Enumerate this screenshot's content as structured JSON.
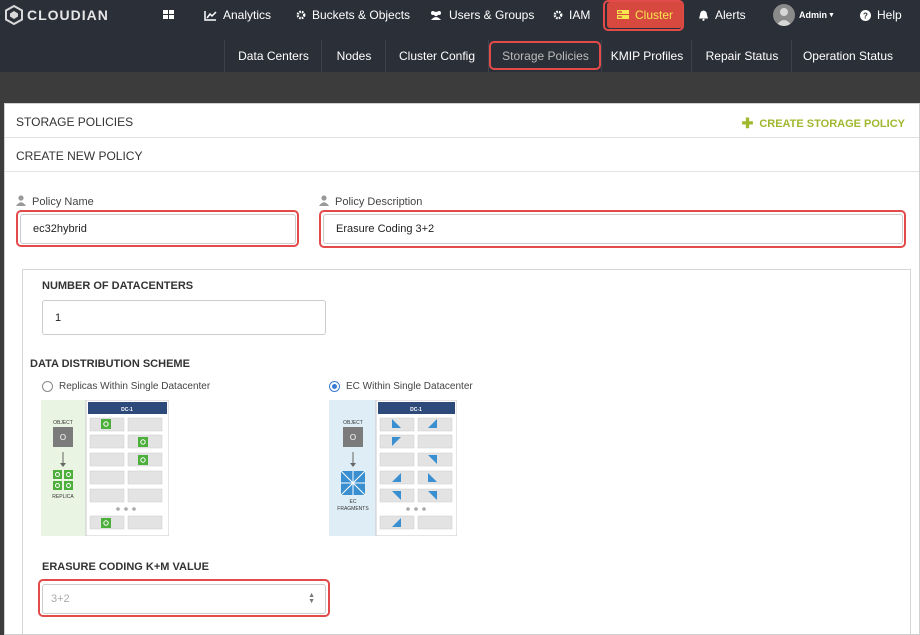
{
  "app": {
    "logo_text": "CLOUDIAN"
  },
  "nav": {
    "analytics": "Analytics",
    "buckets": "Buckets & Objects",
    "users": "Users & Groups",
    "iam": "IAM",
    "cluster": "Cluster",
    "alerts": "Alerts",
    "admin": "Admin",
    "help": "Help"
  },
  "subnav": {
    "data_centers": "Data Centers",
    "nodes": "Nodes",
    "cluster_config": "Cluster Config",
    "storage_policies": "Storage Policies",
    "kmip_profiles": "KMIP Profiles",
    "repair_status": "Repair Status",
    "operation_status": "Operation Status"
  },
  "panel": {
    "title": "STORAGE POLICIES",
    "create_link": "CREATE STORAGE POLICY",
    "subtitle": "CREATE NEW POLICY"
  },
  "form": {
    "policy_name_label": "Policy Name",
    "policy_name_value": "ec32hybrid",
    "policy_desc_label": "Policy Description",
    "policy_desc_value": "Erasure Coding 3+2",
    "num_dc_label": "NUMBER OF DATACENTERS",
    "num_dc_value": "1",
    "scheme_label": "DATA DISTRIBUTION SCHEME",
    "option_replicas": "Replicas Within Single Datacenter",
    "option_ec": "EC Within Single Datacenter",
    "selected_option": "EC Within Single Datacenter",
    "km_label": "ERASURE CODING K+M VALUE",
    "km_value": "3+2"
  },
  "diagrams": {
    "replica": {
      "dc": "DC-1",
      "object": "OBJECT",
      "object_glyph": "O",
      "bottom": "REPLICA"
    },
    "ec": {
      "dc": "DC-1",
      "object": "OBJECT",
      "object_glyph": "O",
      "bottom1": "EC",
      "bottom2": "FRAGMENTS"
    }
  },
  "colors": {
    "topbar": "#2b2f38",
    "cluster_active": "#d7493f",
    "accent_green": "#9fb82d",
    "highlight_red": "#e34a4a",
    "diagram_navy": "#2e4a7a",
    "replica_green": "#4caf3c",
    "ec_blue": "#3a8fd0"
  }
}
